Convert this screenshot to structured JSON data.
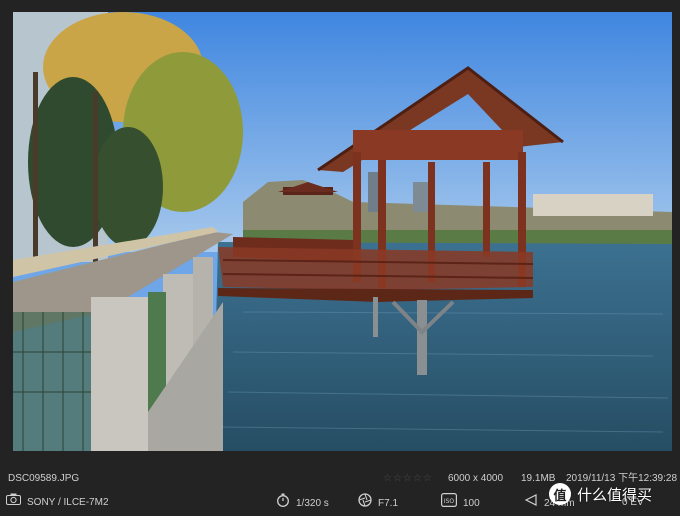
{
  "photo": {
    "description_icon": "photo-canvas"
  },
  "info": {
    "filename": "DSC09589.JPG",
    "rating": "☆☆☆☆☆",
    "dimensions": "6000 x 4000",
    "filesize": "19.1MB",
    "datetime": "2019/11/13 下午12:39:28"
  },
  "exif": {
    "camera": "SONY / ILCE-7M2",
    "shutter": "1/320 s",
    "aperture": "F7.1",
    "iso": "100",
    "focal": "24 mm",
    "ev": "0 EV"
  },
  "watermark": {
    "badge": "值",
    "text": "什么值得买"
  },
  "colors": {
    "background": "#232323",
    "text": "#cfcfcf",
    "sky": "#6fa6e8",
    "water": "#2f5f78",
    "pavilion": "#7a3220"
  }
}
